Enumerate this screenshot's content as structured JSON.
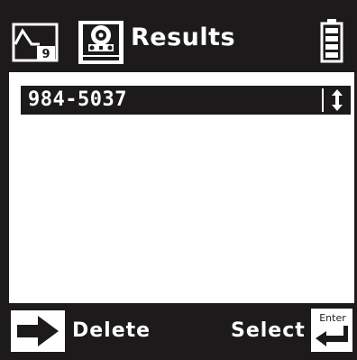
{
  "header": {
    "title": "Results",
    "waveform_badge": "9",
    "icons": [
      "waveform-icon",
      "tape-drive-icon",
      "battery-icon"
    ]
  },
  "results": {
    "items": [
      {
        "label": "984-5037",
        "selected": true
      }
    ],
    "scroll_icon": "up-down-arrow-icon"
  },
  "footer": {
    "delete_label": "Delete",
    "select_label": "Select",
    "enter_key_label": "Enter",
    "icons": [
      "right-arrow-icon",
      "enter-key-icon"
    ]
  },
  "colors": {
    "background": "#1c1a1b",
    "screen": "#ffffff",
    "text_light": "#ffffff"
  }
}
